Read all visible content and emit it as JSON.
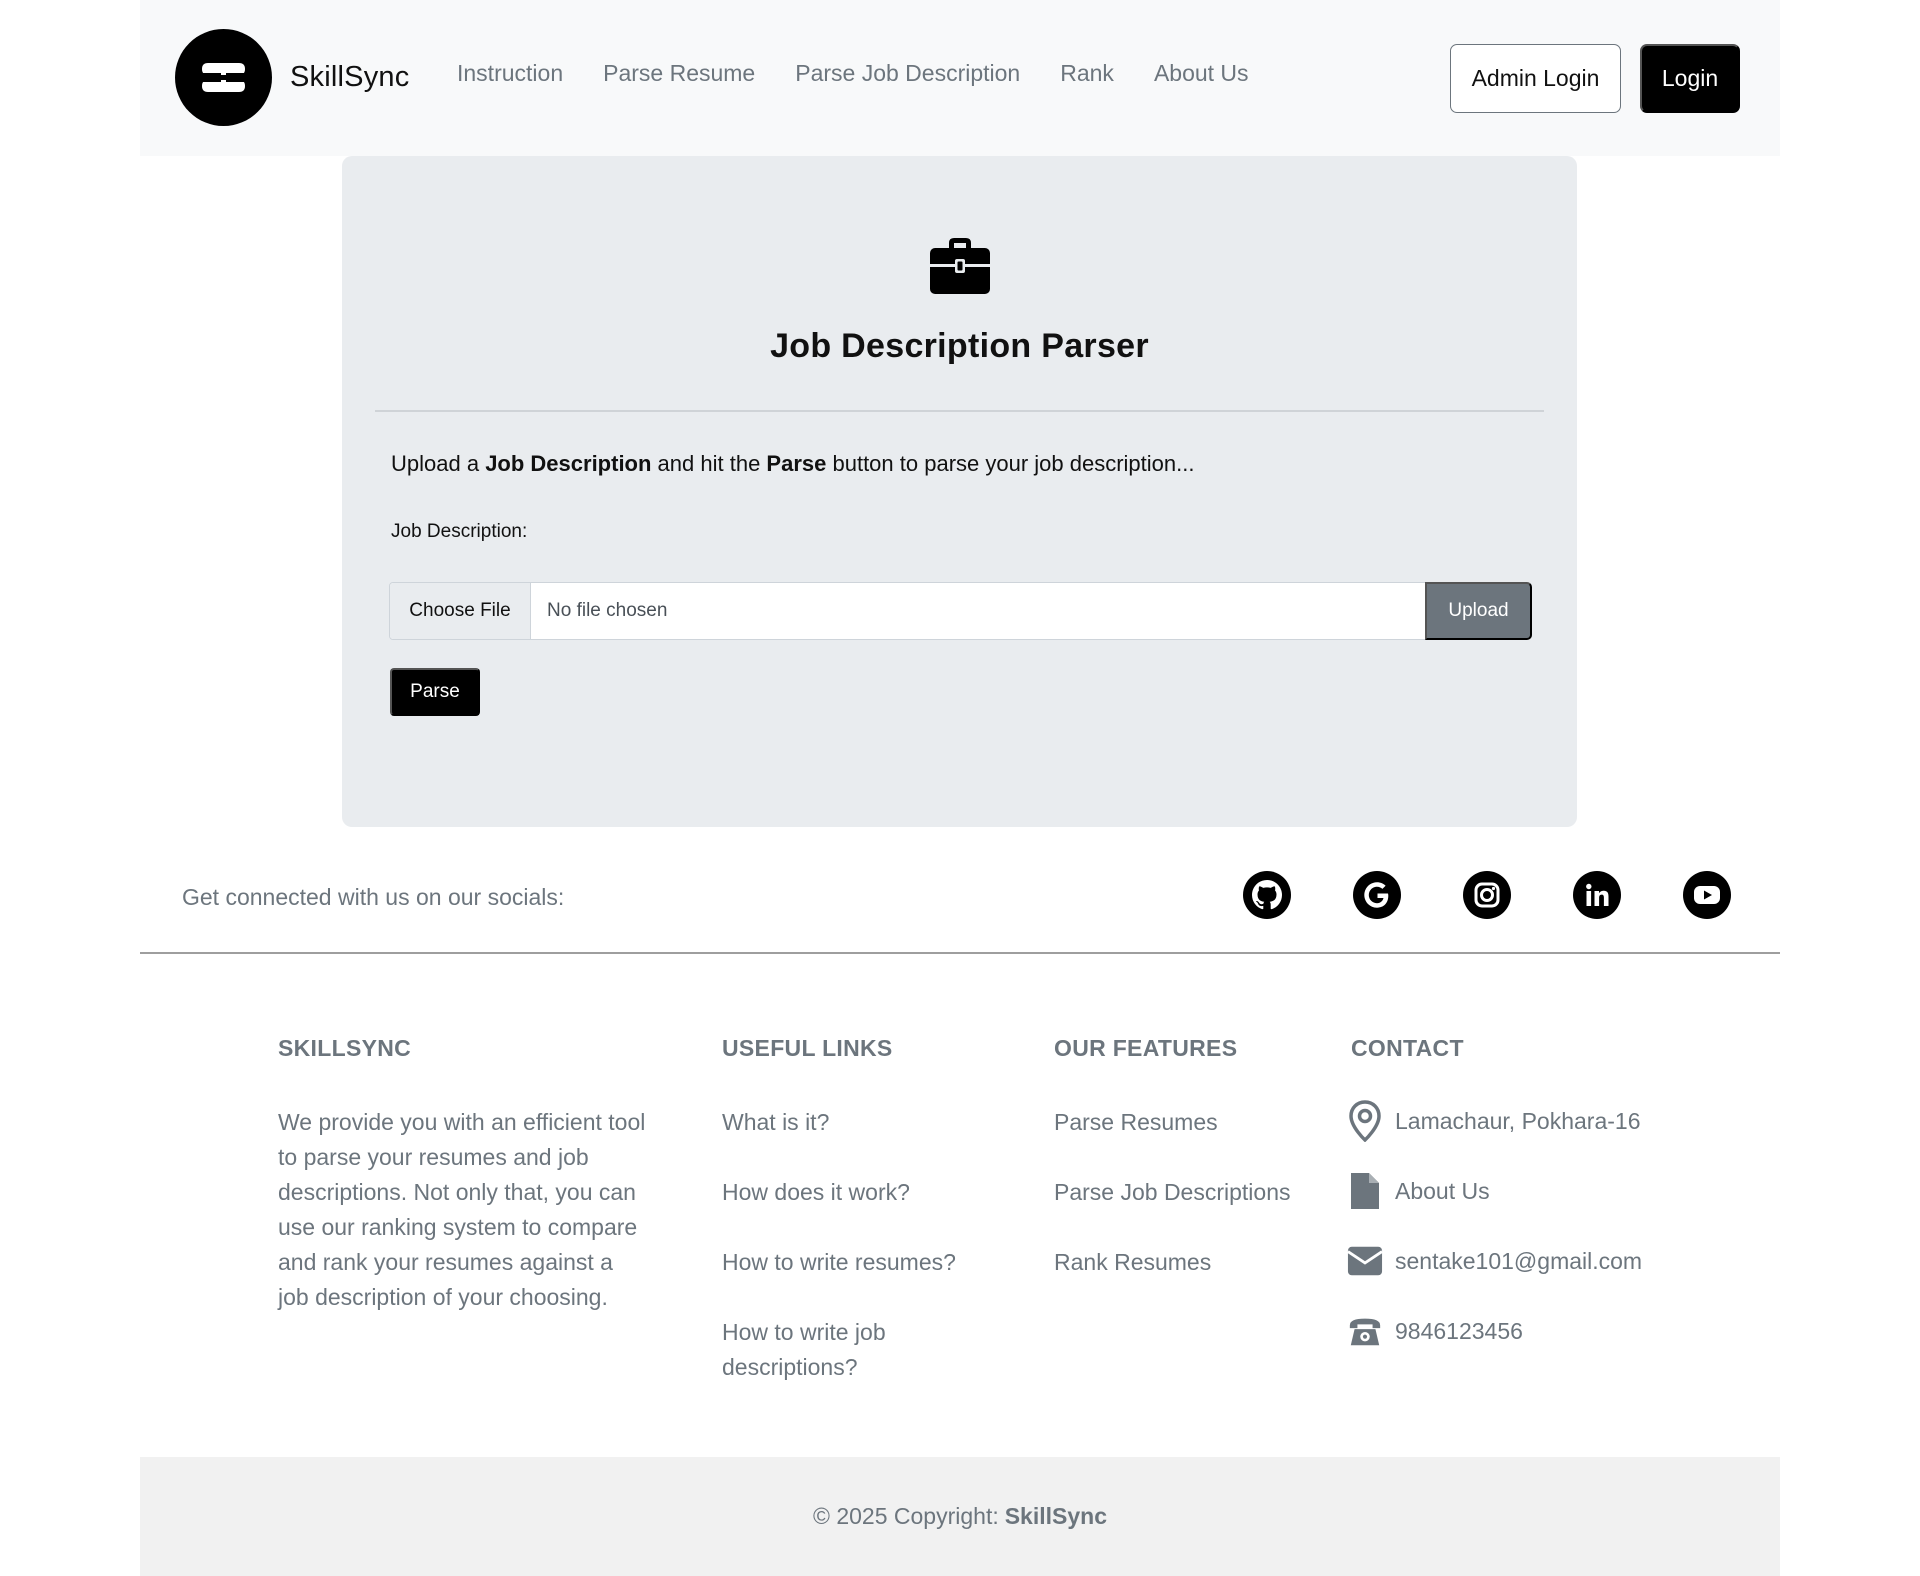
{
  "brand": {
    "name": "SkillSync",
    "logo_icon": "skillsync-logo-icon"
  },
  "nav": {
    "links": [
      "Instruction",
      "Parse Resume",
      "Parse Job Description",
      "Rank",
      "About Us"
    ],
    "admin_login": "Admin Login",
    "login": "Login"
  },
  "card": {
    "icon": "briefcase-icon",
    "title": "Job Description Parser",
    "intro": {
      "pre": "Upload a ",
      "bold1": "Job Description",
      "mid": " and hit the ",
      "bold2": "Parse",
      "post": " button to parse your job description..."
    },
    "field_label": "Job Description:",
    "file_button": "Choose File",
    "file_status": "No file chosen",
    "upload_button": "Upload",
    "parse_button": "Parse"
  },
  "socials": {
    "text": "Get connected with us on our socials:",
    "icons": [
      "github-icon",
      "google-icon",
      "instagram-icon",
      "linkedin-icon",
      "youtube-icon"
    ]
  },
  "footer": {
    "about": {
      "title": "SKILLSYNC",
      "body": "We provide you with an efficient tool to parse your resumes and job descriptions. Not only that, you can use our ranking system to compare and rank your resumes against a job description of your choosing."
    },
    "useful_links": {
      "title": "USEFUL LINKS",
      "items": [
        "What is it?",
        "How does it work?",
        "How to write resumes?",
        "How to write job descriptions?"
      ]
    },
    "features": {
      "title": "OUR FEATURES",
      "items": [
        "Parse Resumes",
        "Parse Job Descriptions",
        "Rank Resumes"
      ]
    },
    "contact": {
      "title": "CONTACT",
      "address": "Lamachaur, Pokhara-16",
      "about": "About Us",
      "email": "sentake101@gmail.com",
      "phone": "9846123456"
    }
  },
  "copyright": {
    "text": "© 2025 Copyright:",
    "brand": "SkillSync"
  },
  "colors": {
    "nav_bg": "#f8f9fa",
    "card_bg": "#e9ecef",
    "muted": "#6c757d",
    "primary": "#000000"
  }
}
